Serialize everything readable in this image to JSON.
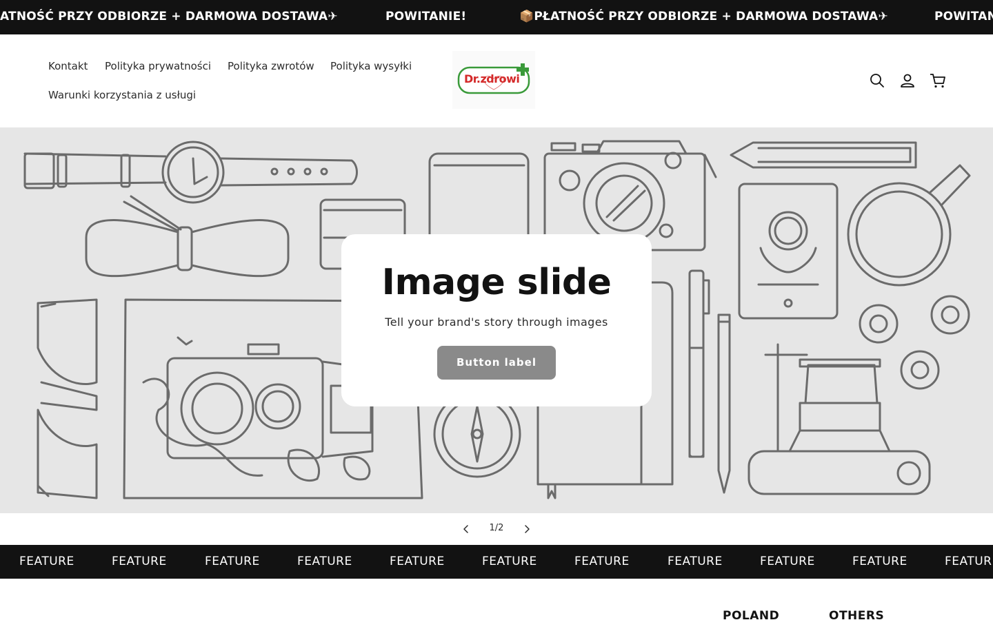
{
  "announcement": {
    "items": [
      "ATNOŚĆ PRZY ODBIORZE + DARMOWA DOSTAWA✈",
      "POWITANIE!",
      "📦PŁATNOŚĆ PRZY ODBIORZE + DARMOWA DOSTAWA✈",
      "POWITAN"
    ]
  },
  "header": {
    "nav": [
      "Kontakt",
      "Polityka prywatności",
      "Polityka zwrotów",
      "Polityka wysyłki",
      "Warunki korzystania z usługi"
    ],
    "logo_text": "Dr.zdrowi",
    "icons": [
      "search-icon",
      "account-icon",
      "cart-icon"
    ]
  },
  "hero": {
    "title": "Image slide",
    "subtitle": "Tell your brand's story through images",
    "button_label": "Button label"
  },
  "slider": {
    "counter": "1/2"
  },
  "features": {
    "items": [
      "FEATURE",
      "FEATURE",
      "FEATURE",
      "FEATURE",
      "FEATURE",
      "FEATURE",
      "FEATURE",
      "FEATURE",
      "FEATURE",
      "FEATURE",
      "FEATUR"
    ]
  },
  "footer": {
    "headings": [
      "POLAND",
      "OTHERS"
    ]
  },
  "colors": {
    "dark": "#121212",
    "hero_bg": "#e6e6e6",
    "button": "#8a8a8a",
    "logo_green": "#3a9a3a",
    "logo_red": "#d42a2a"
  }
}
